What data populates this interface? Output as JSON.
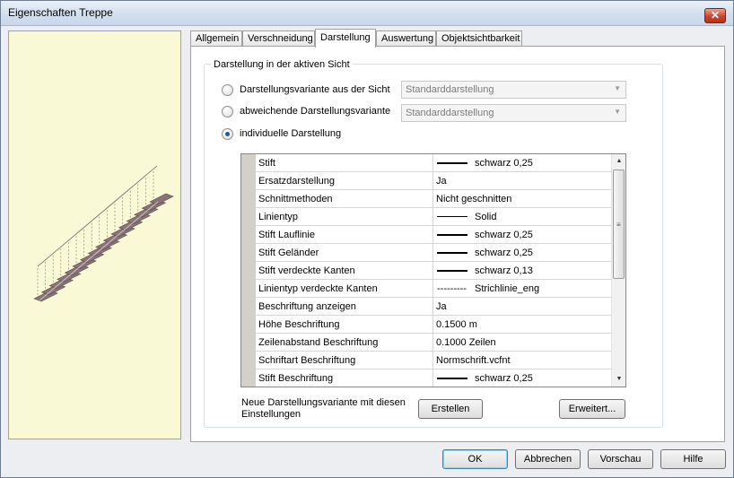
{
  "window": {
    "title": "Eigenschaften Treppe",
    "close_glyph": "✕"
  },
  "tabs": [
    {
      "label": "Allgemein"
    },
    {
      "label": "Verschneidung"
    },
    {
      "label": "Darstellung"
    },
    {
      "label": "Auswertung"
    },
    {
      "label": "Objektsichtbarkeit"
    }
  ],
  "active_tab": "Darstellung",
  "group": {
    "title": "Darstellung in der aktiven Sicht"
  },
  "options": [
    {
      "label": "Darstellungsvariante aus der Sicht",
      "checked": false,
      "combo_value": "Standarddarstellung"
    },
    {
      "label": "abweichende Darstellungsvariante",
      "checked": false,
      "combo_value": "Standarddarstellung"
    },
    {
      "label": "individuelle Darstellung",
      "checked": true
    }
  ],
  "properties": [
    {
      "name": "Stift",
      "value": "schwarz 0,25",
      "kind": "pen",
      "thickness": 2
    },
    {
      "name": "Ersatzdarstellung",
      "value": "Ja",
      "kind": "text"
    },
    {
      "name": "Schnittmethoden",
      "value": "Nicht geschnitten",
      "kind": "text"
    },
    {
      "name": "Linientyp",
      "value": "Solid",
      "kind": "pen",
      "thickness": 1
    },
    {
      "name": "Stift Lauflinie",
      "value": "schwarz 0,25",
      "kind": "pen",
      "thickness": 2
    },
    {
      "name": "Stift Geländer",
      "value": "schwarz 0,25",
      "kind": "pen",
      "thickness": 2
    },
    {
      "name": "Stift verdeckte Kanten",
      "value": "schwarz 0,13",
      "kind": "pen",
      "thickness": 2
    },
    {
      "name": "Linientyp verdeckte Kanten",
      "value": "Strichlinie_eng",
      "kind": "dash",
      "pattern": "---------"
    },
    {
      "name": "Beschriftung anzeigen",
      "value": "Ja",
      "kind": "text"
    },
    {
      "name": "Höhe Beschriftung",
      "value": "0.1500 m",
      "kind": "text"
    },
    {
      "name": "Zeilenabstand Beschriftung",
      "value": "0.1000 Zeilen",
      "kind": "text"
    },
    {
      "name": "Schriftart Beschriftung",
      "value": "Normschrift.vcfnt",
      "kind": "text"
    },
    {
      "name": "Stift Beschriftung",
      "value": "schwarz 0,25",
      "kind": "pen",
      "thickness": 2
    }
  ],
  "scrollbar": {
    "up_glyph": "▲",
    "down_glyph": "▼",
    "grip_glyph": "≡"
  },
  "new_variant": {
    "label": "Neue Darstellungsvariante mit diesen Einstellungen",
    "create_button": "Erstellen",
    "advanced_button": "Erweitert..."
  },
  "footer": {
    "ok": "OK",
    "cancel": "Abbrechen",
    "preview": "Vorschau",
    "help": "Hilfe"
  },
  "colors": {
    "preview_background": "#f9f9d6",
    "stair_fill": "#8a7478",
    "close_button": "#c9462c"
  }
}
